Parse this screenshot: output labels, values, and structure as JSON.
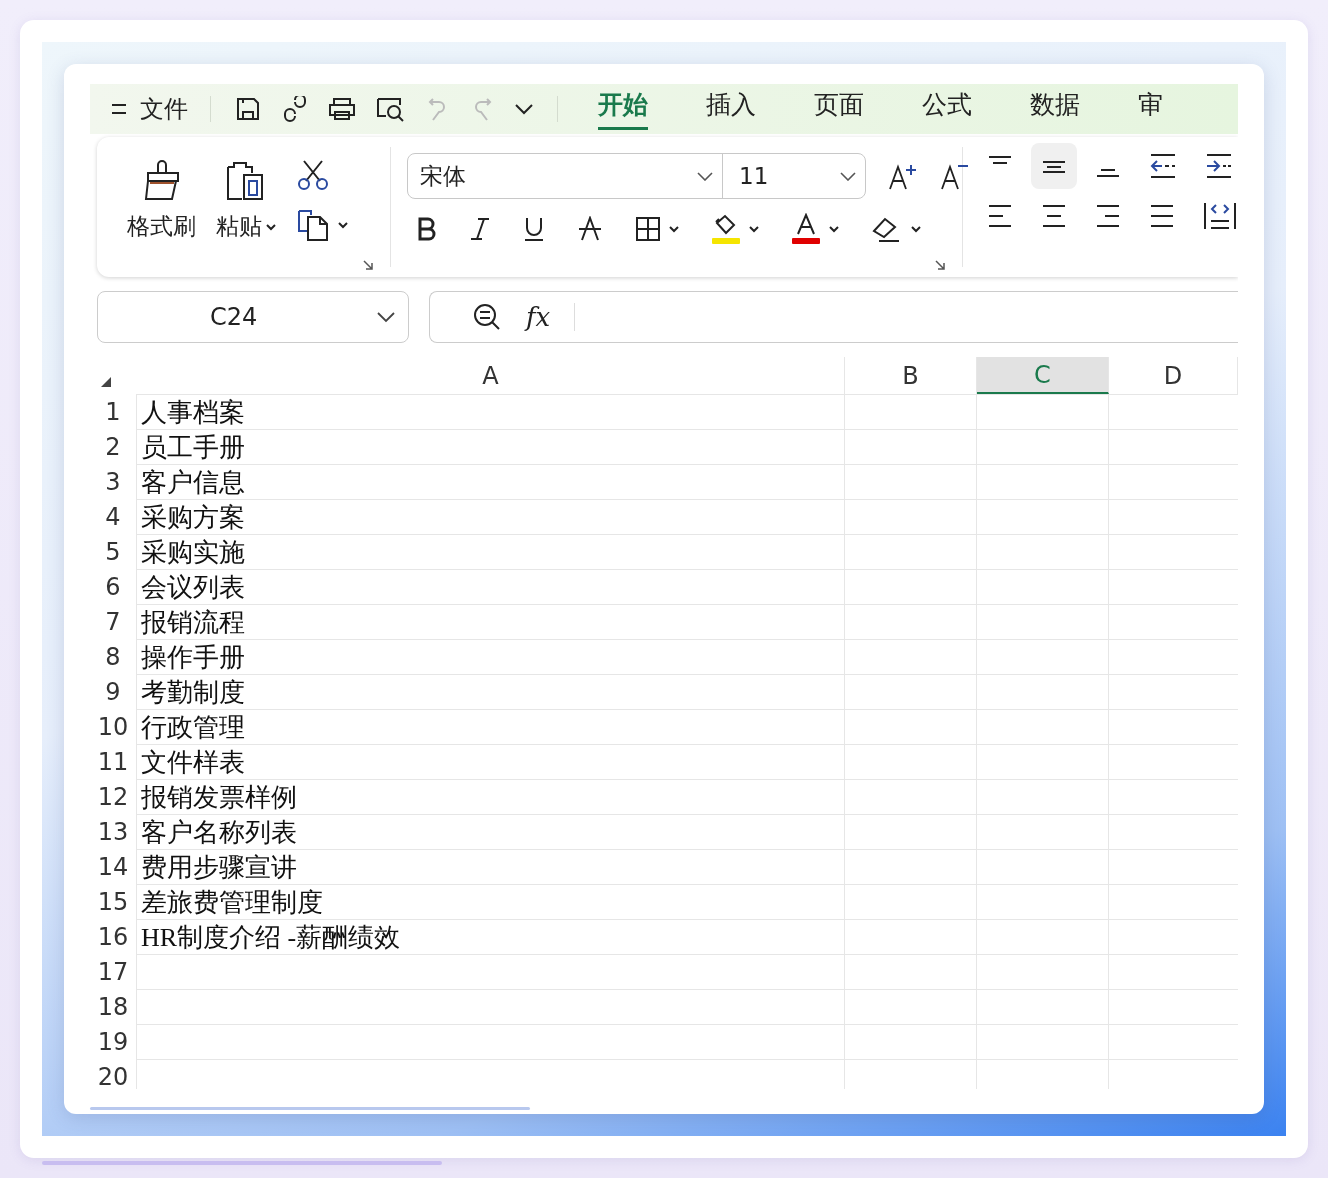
{
  "menu": {
    "label": "文件"
  },
  "tabs": [
    {
      "label": "开始",
      "selected": true
    },
    {
      "label": "插入",
      "selected": false
    },
    {
      "label": "页面",
      "selected": false
    },
    {
      "label": "公式",
      "selected": false
    },
    {
      "label": "数据",
      "selected": false
    },
    {
      "label": "审",
      "selected": false
    }
  ],
  "clipboard": {
    "format_painter": "格式刷",
    "paste": "粘贴"
  },
  "font": {
    "name": "宋体",
    "size": "11"
  },
  "formula_bar": {
    "name_box": "C24",
    "fx": "fx"
  },
  "columns": [
    {
      "label": "A",
      "selected": false
    },
    {
      "label": "B",
      "selected": false
    },
    {
      "label": "C",
      "selected": true
    },
    {
      "label": "D",
      "selected": false
    }
  ],
  "rows": [
    {
      "number": "1",
      "a": "人事档案"
    },
    {
      "number": "2",
      "a": "员工手册"
    },
    {
      "number": "3",
      "a": "客户信息"
    },
    {
      "number": "4",
      "a": "采购方案"
    },
    {
      "number": "5",
      "a": "采购实施"
    },
    {
      "number": "6",
      "a": "会议列表"
    },
    {
      "number": "7",
      "a": "报销流程"
    },
    {
      "number": "8",
      "a": "操作手册"
    },
    {
      "number": "9",
      "a": "考勤制度"
    },
    {
      "number": "10",
      "a": "行政管理"
    },
    {
      "number": "11",
      "a": "文件样表"
    },
    {
      "number": "12",
      "a": "报销发票样例"
    },
    {
      "number": "13",
      "a": "客户名称列表"
    },
    {
      "number": "14",
      "a": "费用步骤宣讲"
    },
    {
      "number": "15",
      "a": "差旅费管理制度"
    },
    {
      "number": "16",
      "a": "HR制度介绍 -薪酬绩效"
    },
    {
      "number": "17"
    },
    {
      "number": "18"
    },
    {
      "number": "19"
    },
    {
      "number": "20"
    }
  ]
}
